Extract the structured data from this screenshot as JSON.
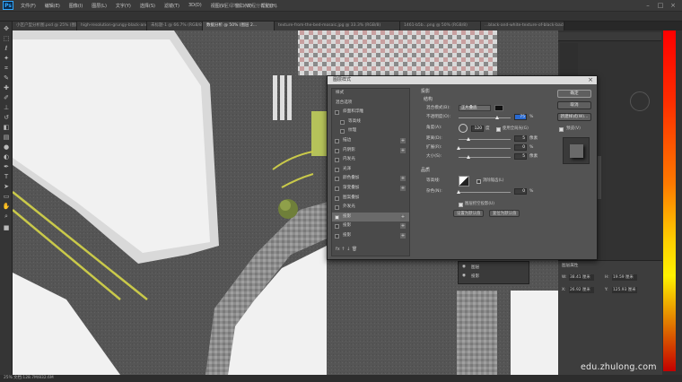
{
  "app": {
    "logo": "Ps"
  },
  "menu": [
    "文件(F)",
    "编辑(E)",
    "图像(I)",
    "图层(L)",
    "文字(Y)",
    "选择(S)",
    "滤镜(T)",
    "3D(D)",
    "视图(V)",
    "窗口(W)",
    "帮助(H)"
  ],
  "window_title": "小区绿地设计流程分析全套...",
  "doc_tabs": [
    "小区户型分析图.psd @ 25% (图层 1...",
    "high-resolution-grungy-black-and...",
    "未标题-1 @ 66.7% (RGB/8)",
    "数据分析 @ 50% (图层 2...",
    "texture-from-the-bed-mosaic.jpg @ 33.3% (RGB/8)",
    "1461-b5b...png @ 50% (RGB/8)",
    "...black-and-white-texture-of-black-background..."
  ],
  "dialog": {
    "title": "图层样式",
    "close": "×",
    "left_list": [
      {
        "label": "样式",
        "heading": true
      },
      {
        "label": "混合选项",
        "heading": true
      },
      {
        "label": "斜面和浮雕",
        "checked": false
      },
      {
        "label": "等高线",
        "checked": false,
        "indent": true
      },
      {
        "label": "纹理",
        "checked": false,
        "indent": true
      },
      {
        "label": "描边",
        "checked": false,
        "plus": true
      },
      {
        "label": "内阴影",
        "checked": false,
        "plus": true
      },
      {
        "label": "内发光",
        "checked": false
      },
      {
        "label": "光泽",
        "checked": false
      },
      {
        "label": "颜色叠加",
        "checked": false,
        "plus": true
      },
      {
        "label": "渐变叠加",
        "checked": false,
        "plus": true
      },
      {
        "label": "图案叠加",
        "checked": false
      },
      {
        "label": "外发光",
        "checked": false
      },
      {
        "label": "投影",
        "checked": true,
        "plus": true,
        "selected": true
      },
      {
        "label": "投影",
        "checked": false,
        "plus": true
      },
      {
        "label": "投影",
        "checked": false,
        "plus": true
      }
    ],
    "bottom_icons": "fx  ↑  ↓  🗑",
    "section_title": "投影",
    "structure_title": "结构",
    "blend_mode": {
      "label": "混合模式(B):",
      "value": "正片叠底"
    },
    "opacity": {
      "label": "不透明度(O):",
      "value": "75",
      "unit": "%",
      "level": 0.75
    },
    "angle": {
      "label": "角度(A):",
      "value": "120",
      "unit": "度",
      "global_light": "使用全局光(G)"
    },
    "distance": {
      "label": "距离(D):",
      "value": "5",
      "unit": "像素",
      "level": 0.2
    },
    "spread": {
      "label": "扩展(R):",
      "value": "0",
      "unit": "%",
      "level": 0.0
    },
    "size": {
      "label": "大小(S):",
      "value": "5",
      "unit": "像素",
      "level": 0.2
    },
    "quality_title": "品质",
    "contour": {
      "label": "等高线:",
      "anti_alias": "消除锯齿(L)"
    },
    "noise": {
      "label": "杂色(N):",
      "value": "0",
      "unit": "%",
      "level": 0.0
    },
    "layer_knocks_out": "图层挖空投影(U)",
    "make_default": "设置为默认值",
    "reset_default": "复位为默认值",
    "buttons": {
      "ok": "确定",
      "cancel": "取消",
      "new_style": "新建样式(W)...",
      "preview": "预览(V)"
    }
  },
  "layers_mini": {
    "row1": "图层",
    "row2": "投影"
  },
  "props": {
    "title": "图层属性",
    "w_label": "W:",
    "w_value": "38.41 厘米",
    "h_label": "H:",
    "h_value": "19.59 厘米",
    "x_label": "X:",
    "x_value": "26.92 厘米",
    "y_label": "Y:",
    "y_value": "125.93 厘米"
  },
  "status": "25% 文档:128.7M/832.6M",
  "watermark": "edu.zhulong.com",
  "colors": {
    "canvas_road": "#5a5a5a",
    "canvas_white": "#f1f1f1",
    "road_stripe": "#c9c94a",
    "dialog_bg": "#535353",
    "accent_blue": "#31a8ff"
  }
}
